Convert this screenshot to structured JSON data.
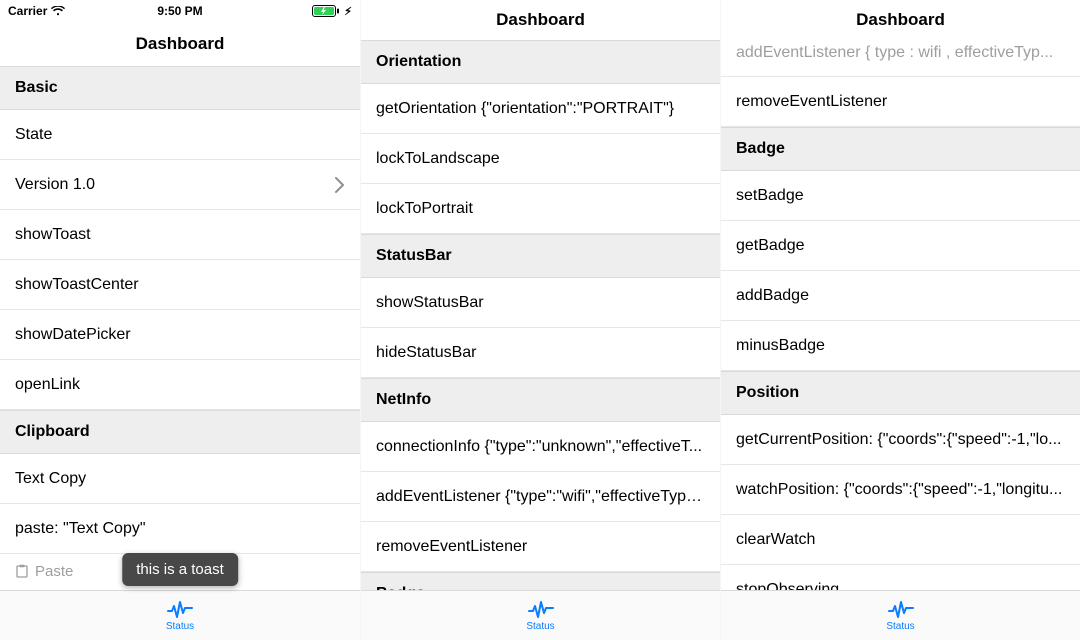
{
  "statusbar": {
    "carrier": "Carrier",
    "time": "9:50 PM"
  },
  "nav_title": "Dashboard",
  "tabbar": {
    "label": "Status"
  },
  "toast": "this is a toast",
  "screen1": {
    "section_basic": "Basic",
    "rows_basic": [
      "State",
      "Version 1.0",
      "showToast",
      "showToastCenter",
      "showDatePicker",
      "openLink"
    ],
    "section_clipboard": "Clipboard",
    "rows_clipboard": [
      "Text Copy",
      "paste: \"Text Copy\""
    ],
    "paste_hint": "Paste"
  },
  "screen2": {
    "partial_top": "",
    "section_orientation": "Orientation",
    "rows_orientation": [
      "getOrientation {\"orientation\":\"PORTRAIT\"}",
      "lockToLandscape",
      "lockToPortrait"
    ],
    "section_statusbar": "StatusBar",
    "rows_statusbar": [
      "showStatusBar",
      "hideStatusBar"
    ],
    "section_netinfo": "NetInfo",
    "rows_netinfo": [
      "connectionInfo {\"type\":\"unknown\",\"effectiveT...",
      "addEventListener {\"type\":\"wifi\",\"effectiveType...",
      "removeEventListener"
    ],
    "section_badge": "Badge"
  },
  "screen3": {
    "partial_top": "addEventListener { type : wifi , effectiveTyp...",
    "rows_netinfo_tail": [
      "removeEventListener"
    ],
    "section_badge": "Badge",
    "rows_badge": [
      "setBadge",
      "getBadge",
      "addBadge",
      "minusBadge"
    ],
    "section_position": "Position",
    "rows_position": [
      "getCurrentPosition: {\"coords\":{\"speed\":-1,\"lo...",
      "watchPosition: {\"coords\":{\"speed\":-1,\"longitu...",
      "clearWatch",
      "stopObserving"
    ]
  }
}
